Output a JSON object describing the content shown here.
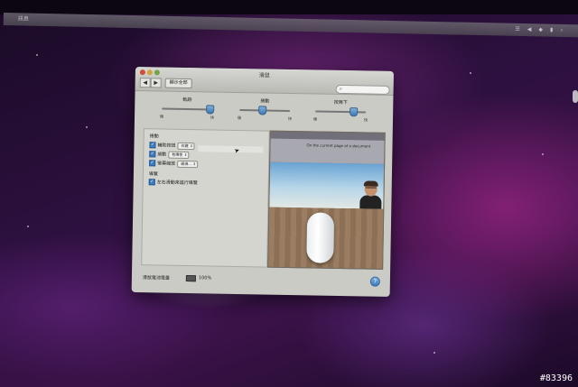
{
  "menubar": {
    "items": [
      "訊息",
      "訊息",
      "訊息"
    ],
    "tray": [
      "☰",
      "◀",
      "◆",
      "▮",
      "⌕"
    ]
  },
  "window": {
    "title": "滑鼠",
    "nav": {
      "back": "◀",
      "forward": "▶"
    },
    "show_all_label": "顯示全部",
    "search": {
      "placeholder": "",
      "icon": "search-icon"
    }
  },
  "sliders": [
    {
      "label": "軌跡",
      "min": "慢",
      "max": "快",
      "level": 0.95
    },
    {
      "label": "捲動",
      "min": "慢",
      "max": "快",
      "level": 0.45
    },
    {
      "label": "按兩下",
      "min": "慢",
      "max": "快",
      "level": 0.75
    }
  ],
  "options": {
    "section_1": "捲動",
    "rows": [
      {
        "label": "輔助按鈕",
        "checked": true,
        "popup": "右鍵"
      },
      {
        "label": "捲動",
        "checked": true,
        "popup": "有慣性"
      },
      {
        "label": "螢幕縮放",
        "checked": true,
        "popup": "選項..."
      }
    ],
    "section_2": "導覽",
    "row_4": {
      "label": "左右滑動來進行導覽",
      "checked": true
    }
  },
  "preview": {
    "caption": "On the current page of a document"
  },
  "bottom": {
    "battery_label": "滑鼠電池電量",
    "battery_pct": "100%",
    "help": "?"
  },
  "watermark": "#83396"
}
